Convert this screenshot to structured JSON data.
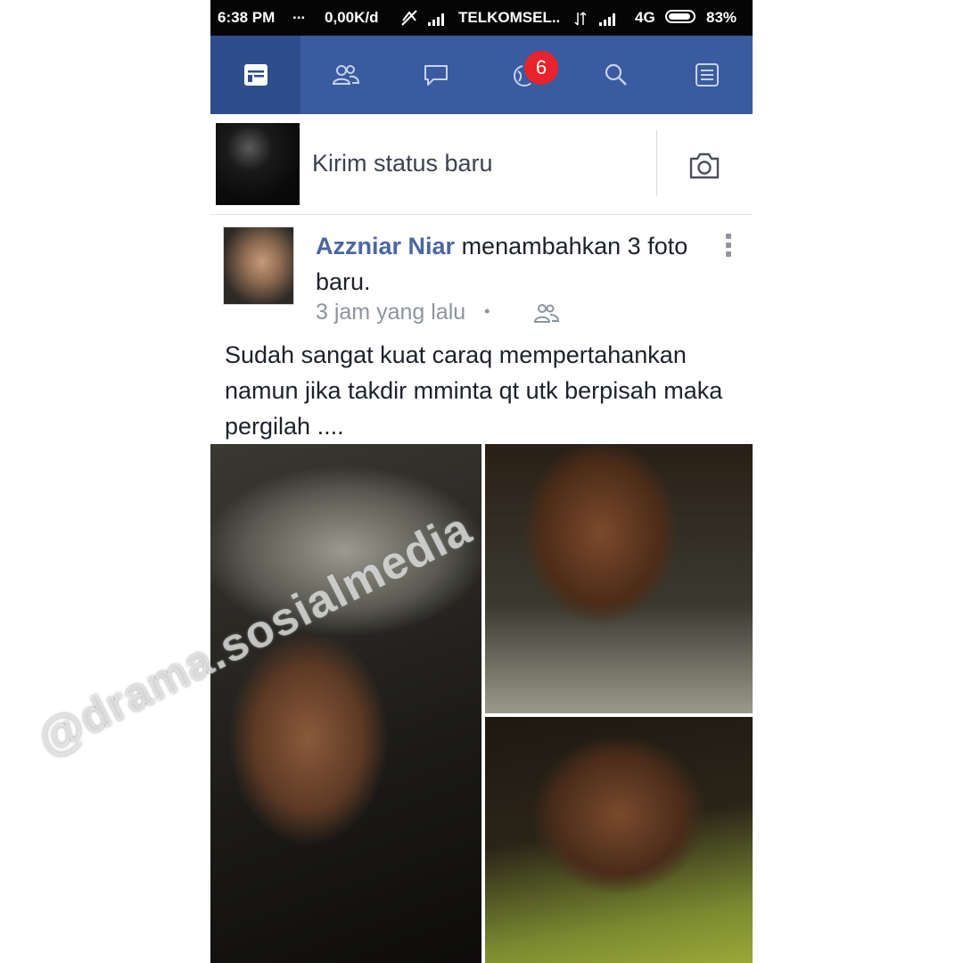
{
  "statusbar": {
    "time": "6:38 PM",
    "dots": "...",
    "speed": "0,00K/d",
    "carrier": "TELKOMSEL..",
    "network": "4G",
    "battery": "83%"
  },
  "navbar": {
    "items": [
      {
        "name": "news-feed",
        "icon": "news-feed-icon",
        "active": true
      },
      {
        "name": "friends",
        "icon": "friends-icon"
      },
      {
        "name": "messages",
        "icon": "chat-icon"
      },
      {
        "name": "notifications",
        "icon": "globe-icon"
      },
      {
        "name": "search",
        "icon": "search-icon"
      },
      {
        "name": "menu",
        "icon": "list-icon"
      }
    ],
    "notification_count": "6",
    "colors": {
      "bar": "#3a5b9f",
      "active": "#2e4d8d",
      "badge": "#e8232b"
    }
  },
  "composer": {
    "placeholder": "Kirim status baru",
    "camera_icon": "camera-icon"
  },
  "post": {
    "author": "Azzniar Niar",
    "action": "menambahkan 3 foto baru.",
    "time": "3 jam yang lalu",
    "separator": "•",
    "privacy_icon": "friends-icon",
    "body": "Sudah sangat kuat caraq mempertahankan namun jika takdir mminta qt utk berpisah maka pergilah ....",
    "photo_count": 3
  },
  "watermark": "@drama.sosialmedia"
}
